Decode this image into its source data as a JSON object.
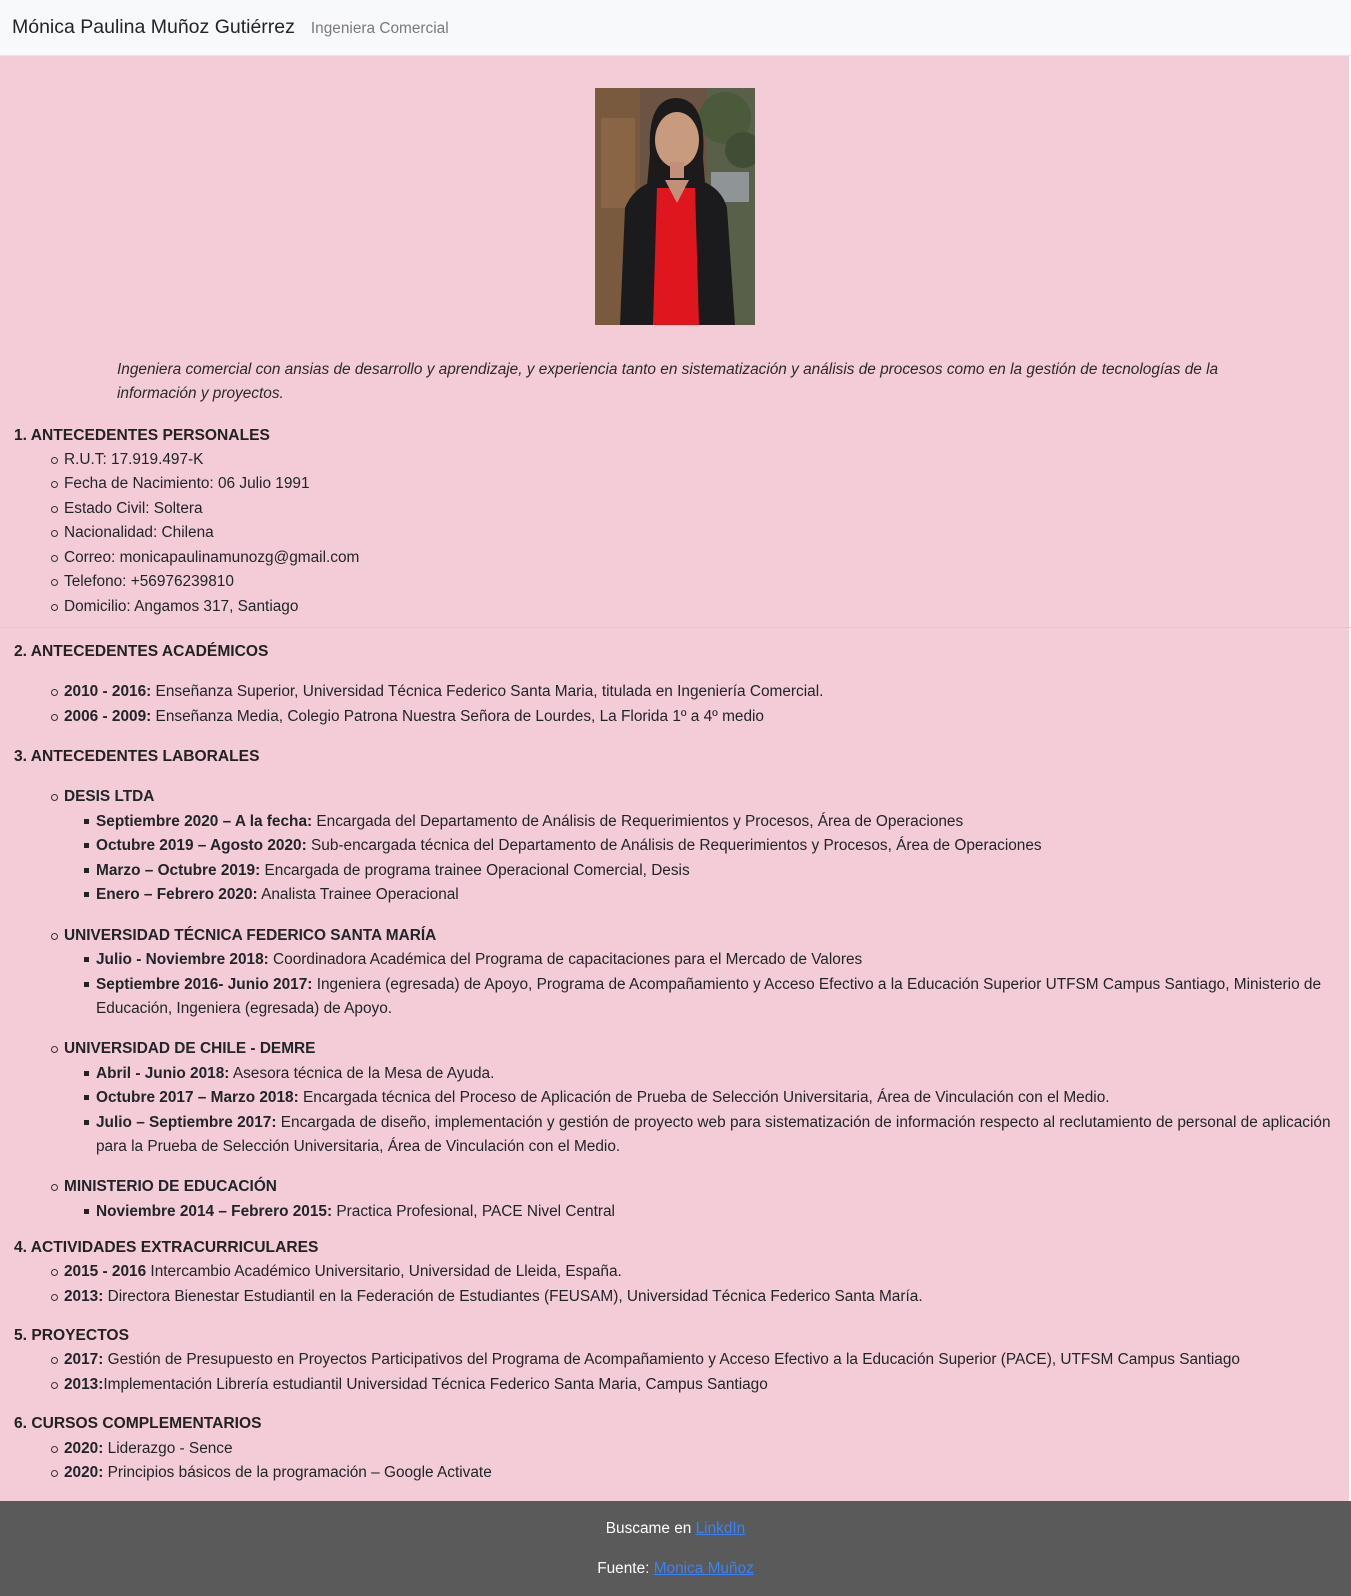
{
  "header": {
    "name": "Mónica Paulina Muñoz Gutiérrez",
    "profession": "Ingeniera Comercial"
  },
  "summary": "Ingeniera comercial con ansias de desarrollo y aprendizaje, y experiencia tanto en sistematización y análisis de procesos como en la gestión de tecnologías de la información y proyectos.",
  "personal": {
    "title": "1. ANTECEDENTES PERSONALES",
    "items": [
      "R.U.T: 17.919.497-K",
      "Fecha de Nacimiento: 06 Julio 1991",
      "Estado Civil: Soltera",
      "Nacionalidad: Chilena",
      "Correo: monicapaulinamunozg@gmail.com",
      "Telefono: +56976239810",
      "Domicilio: Angamos 317, Santiago"
    ]
  },
  "academic": {
    "title": "2. ANTECEDENTES ACADÉMICOS",
    "items": [
      {
        "label": "2010 - 2016:",
        "text": " Enseñanza Superior, Universidad Técnica Federico Santa Maria, titulada en Ingeniería Comercial."
      },
      {
        "label": "2006 - 2009:",
        "text": " Enseñanza Media, Colegio Patrona Nuestra Señora de Lourdes, La Florida 1º a 4º medio"
      }
    ]
  },
  "work": {
    "title": "3. ANTECEDENTES LABORALES",
    "orgs": [
      {
        "name": "DESIS LTDA",
        "items": [
          {
            "label": "Septiembre 2020 – A la fecha:",
            "text": " Encargada del Departamento de Análisis de Requerimientos y Procesos, Área de Operaciones"
          },
          {
            "label": "Octubre 2019 – Agosto 2020:",
            "text": " Sub-encargada técnica del Departamento de Análisis de Requerimientos y Procesos, Área de Operaciones"
          },
          {
            "label": "Marzo – Octubre 2019:",
            "text": " Encargada de programa trainee Operacional Comercial, Desis"
          },
          {
            "label": "Enero – Febrero 2020:",
            "text": " Analista Trainee Operacional"
          }
        ]
      },
      {
        "name": "UNIVERSIDAD TÉCNICA FEDERICO SANTA MARÍA",
        "items": [
          {
            "label": "Julio - Noviembre 2018:",
            "text": " Coordinadora Académica del Programa de capacitaciones para el Mercado de Valores"
          },
          {
            "label": "Septiembre 2016- Junio 2017:",
            "text": " Ingeniera (egresada) de Apoyo, Programa de Acompañamiento y Acceso Efectivo a la Educación Superior UTFSM Campus Santiago, Ministerio de Educación, Ingeniera (egresada) de Apoyo."
          }
        ]
      },
      {
        "name": "UNIVERSIDAD DE CHILE - DEMRE",
        "items": [
          {
            "label": "Abril - Junio 2018:",
            "text": " Asesora técnica de la Mesa de Ayuda."
          },
          {
            "label": "Octubre 2017 – Marzo 2018:",
            "text": " Encargada técnica del Proceso de Aplicación de Prueba de Selección Universitaria, Área de Vinculación con el Medio."
          },
          {
            "label": "Julio – Septiembre 2017:",
            "text": " Encargada de diseño, implementación y gestión de proyecto web para sistematización de información respecto al reclutamiento de personal de aplicación para la Prueba de Selección Universitaria, Área de Vinculación con el Medio."
          }
        ]
      },
      {
        "name": "MINISTERIO DE EDUCACIÓN",
        "items": [
          {
            "label": "Noviembre 2014 – Febrero 2015:",
            "text": " Practica Profesional, PACE Nivel Central"
          }
        ]
      }
    ]
  },
  "extracurricular": {
    "title": "4. ACTIVIDADES EXTRACURRICULARES",
    "items": [
      {
        "label": "2015 - 2016",
        "text": " Intercambio Académico Universitario, Universidad de Lleida, España."
      },
      {
        "label": "2013:",
        "text": " Directora Bienestar Estudiantil en la Federación de Estudiantes (FEUSAM), Universidad Técnica Federico Santa María."
      }
    ]
  },
  "projects": {
    "title": "5. PROYECTOS",
    "items": [
      {
        "label": "2017:",
        "text": " Gestión de Presupuesto en Proyectos Participativos del Programa de Acompañamiento y Acceso Efectivo a la Educación Superior (PACE), UTFSM Campus Santiago"
      },
      {
        "label": "2013:",
        "text": "Implementación Librería estudiantil Universidad Técnica Federico Santa Maria, Campus Santiago"
      }
    ]
  },
  "courses": {
    "title": "6. CURSOS COMPLEMENTARIOS",
    "items": [
      {
        "label": "2020:",
        "text": " Liderazgo - Sence"
      },
      {
        "label": "2020:",
        "text": " Principios básicos de la programación – Google Activate"
      }
    ]
  },
  "footer": {
    "find_prefix": "Buscame en ",
    "find_link": "LinkdIn",
    "source_prefix": "Fuente: ",
    "source_link": "Monica Muñoz"
  },
  "colors": {
    "page_background": "#f3ccd7",
    "footer_background": "#5a5a5a",
    "link": "#3b82f6"
  }
}
